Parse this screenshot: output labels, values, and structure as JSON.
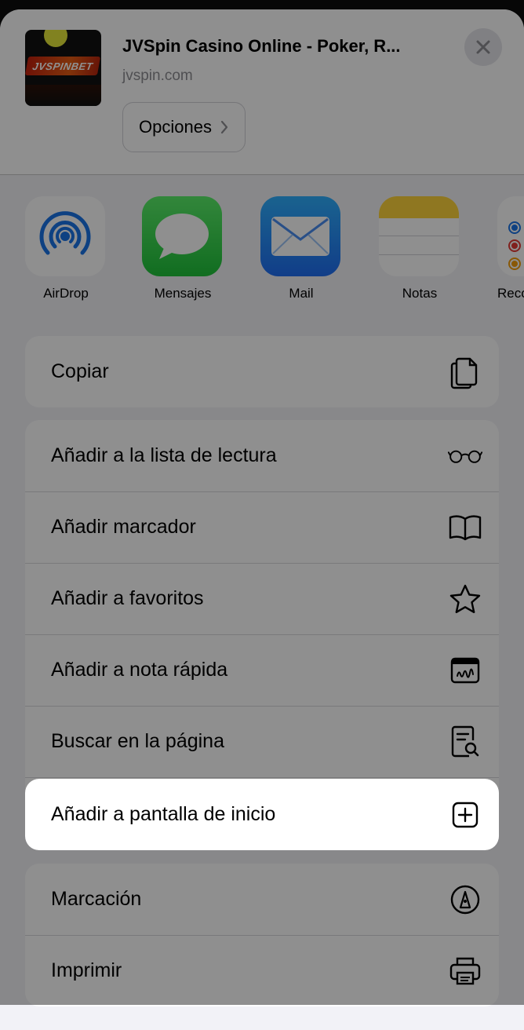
{
  "header": {
    "thumbnail_logo_text": "JVSPINBET",
    "title": "JVSpin Casino Online - Poker, R...",
    "domain": "jvspin.com",
    "options_label": "Opciones"
  },
  "apps": [
    {
      "label": "AirDrop",
      "icon": "airdrop-icon"
    },
    {
      "label": "Mensajes",
      "icon": "messages-icon"
    },
    {
      "label": "Mail",
      "icon": "mail-icon"
    },
    {
      "label": "Notas",
      "icon": "notes-icon"
    },
    {
      "label": "Reco",
      "icon": "reminders-icon"
    }
  ],
  "actions_group1": [
    {
      "label": "Copiar",
      "icon": "copy-icon"
    }
  ],
  "actions_group2": [
    {
      "label": "Añadir a la lista de lectura",
      "icon": "glasses-icon"
    },
    {
      "label": "Añadir marcador",
      "icon": "book-icon"
    },
    {
      "label": "Añadir a favoritos",
      "icon": "star-icon"
    },
    {
      "label": "Añadir a nota rápida",
      "icon": "quick-note-icon"
    },
    {
      "label": "Buscar en la página",
      "icon": "find-in-page-icon"
    },
    {
      "label": "Añadir a pantalla de inicio",
      "icon": "add-square-icon"
    }
  ],
  "actions_group3": [
    {
      "label": "Marcación",
      "icon": "markup-icon"
    },
    {
      "label": "Imprimir",
      "icon": "printer-icon"
    }
  ],
  "colors": {
    "sheet_background": "#f2f2f7",
    "overlay": "rgba(0,0,0,0.44)",
    "highlight_background": "#ffffff"
  }
}
